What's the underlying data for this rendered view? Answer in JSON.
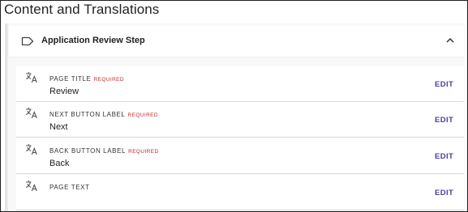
{
  "page": {
    "title": "Content and Translations"
  },
  "step": {
    "title": "Application Review Step",
    "icon": "tag-icon",
    "toggle_icon": "chevron-up-icon"
  },
  "fields": [
    {
      "label": "PAGE TITLE",
      "required": "REQUIRED",
      "value": "Review",
      "action": "EDIT",
      "icon": "translate-icon"
    },
    {
      "label": "NEXT BUTTON LABEL",
      "required": "REQUIRED",
      "value": "Next",
      "action": "EDIT",
      "icon": "translate-icon"
    },
    {
      "label": "BACK BUTTON LABEL",
      "required": "REQUIRED",
      "value": "Back",
      "action": "EDIT",
      "icon": "translate-icon"
    },
    {
      "label": "PAGE TEXT",
      "action": "EDIT",
      "icon": "translate-icon"
    }
  ],
  "colors": {
    "required": "#c62828",
    "edit": "#4b3f9e",
    "panel": "#f8f8f8"
  }
}
